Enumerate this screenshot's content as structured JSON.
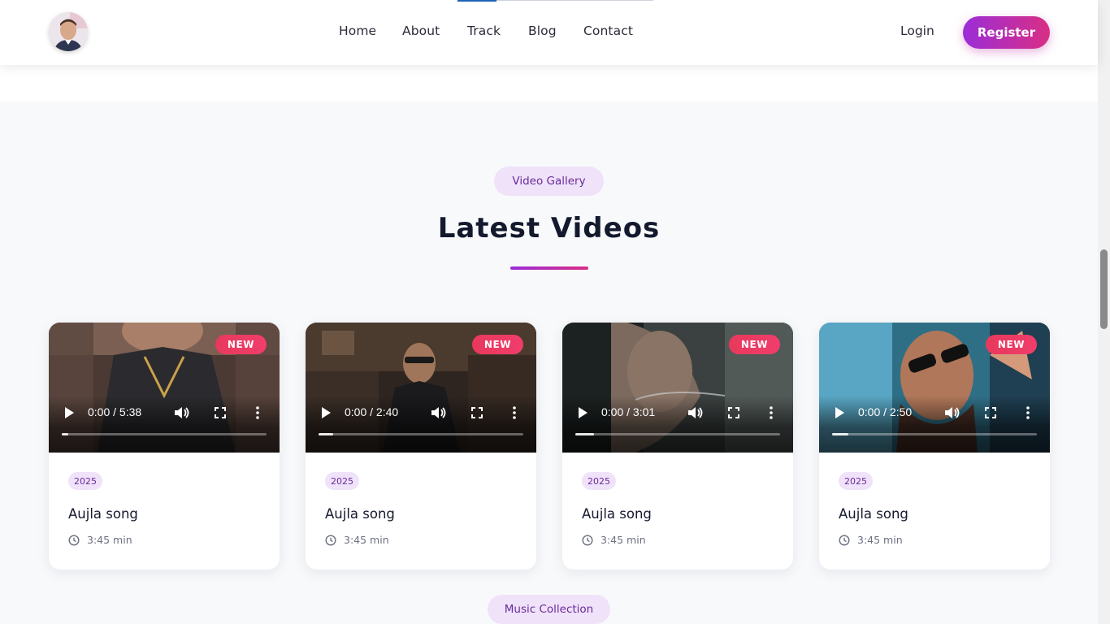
{
  "header": {
    "nav": [
      "Home",
      "About",
      "Track",
      "Blog",
      "Contact"
    ],
    "login_label": "Login",
    "register_label": "Register",
    "brand_accent": "#9b2dd8",
    "brand_accent_2": "#d92e84"
  },
  "section": {
    "gallery_label": "Video Gallery",
    "title": "Latest Videos",
    "next_label": "Music Collection"
  },
  "cards": [
    {
      "badge": "NEW",
      "time": "0:00 / 5:38",
      "year": "2025",
      "title": "Aujla song",
      "duration": "3:45 min",
      "progress": 0.03
    },
    {
      "badge": "NEW",
      "time": "0:00 / 2:40",
      "year": "2025",
      "title": "Aujla song",
      "duration": "3:45 min",
      "progress": 0.07
    },
    {
      "badge": "NEW",
      "time": "0:00 / 3:01",
      "year": "2025",
      "title": "Aujla song",
      "duration": "3:45 min",
      "progress": 0.09
    },
    {
      "badge": "NEW",
      "time": "0:00 / 2:50",
      "year": "2025",
      "title": "Aujla song",
      "duration": "3:45 min",
      "progress": 0.08
    }
  ],
  "icons": [
    "avatar",
    "play-icon",
    "volume-icon",
    "fullscreen-icon",
    "more-vertical-icon",
    "clock-icon"
  ]
}
